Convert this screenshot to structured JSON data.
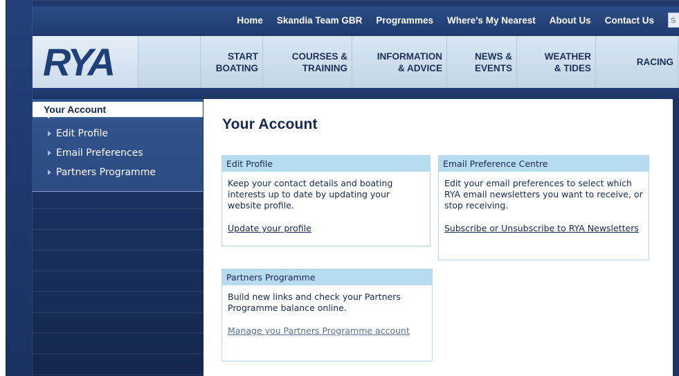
{
  "topnav": {
    "items": [
      "Home",
      "Skandia Team GBR",
      "Programmes",
      "Where's My Nearest",
      "About Us",
      "Contact Us"
    ],
    "search_placeholder": "S"
  },
  "logo": {
    "text": "RYA"
  },
  "menu": {
    "items": [
      "START\nBOATING",
      "COURSES &\nTRAINING",
      "INFORMATION\n& ADVICE",
      "NEWS &\nEVENTS",
      "WEATHER\n& TIDES",
      "RACING"
    ]
  },
  "sidebar": {
    "heading": "Your Account",
    "items": [
      "Edit Profile",
      "Email Preferences",
      "Partners Programme"
    ]
  },
  "main": {
    "title": "Your Account",
    "cards": [
      {
        "title": "Edit Profile",
        "desc": "Keep your contact details and boating interests up to date by updating your website profile.",
        "link": "Update your profile"
      },
      {
        "title": "Email Preference Centre",
        "desc": "Edit your email preferences to select which RYA email newsletters you want to receive, or stop receiving.",
        "link": "Subscribe or Unsubscribe to RYA Newsletters"
      },
      {
        "title": "Partners Programme",
        "desc": "Build new links and check your Partners Programme balance online.",
        "link": "Manage you Partners Programme account"
      }
    ]
  },
  "colors": {
    "navy": "#14284f",
    "header_band": "#c3d6e8",
    "card_head": "#b8dcef",
    "sidebar": "#2c4b82"
  }
}
